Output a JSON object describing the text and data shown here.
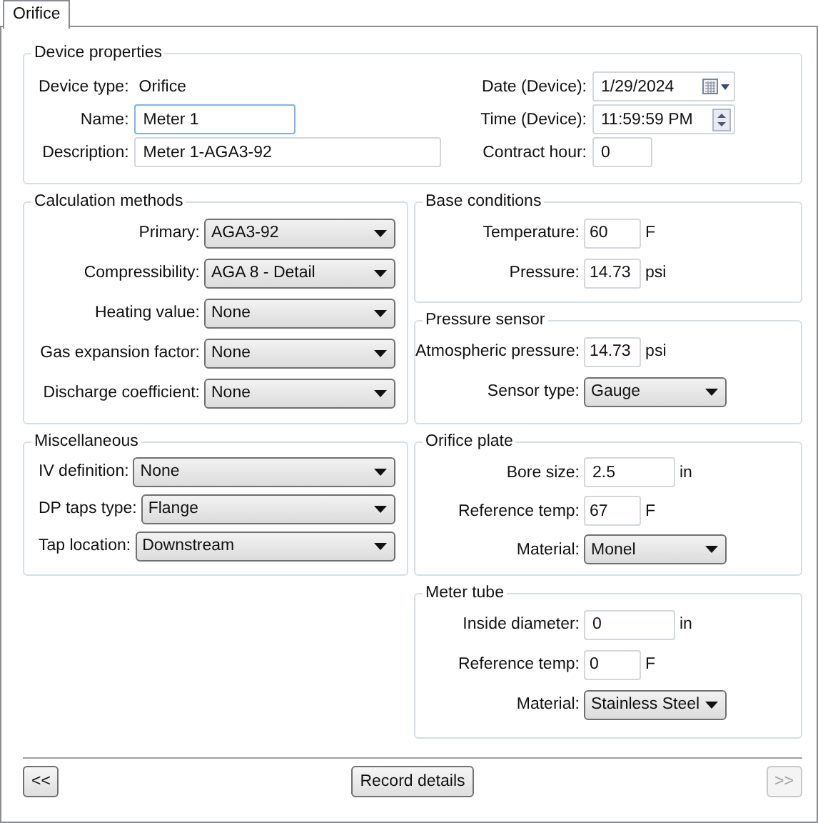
{
  "tab": {
    "label": "Orifice",
    "selected": true
  },
  "device_properties": {
    "title": "Device properties",
    "left": [
      {
        "kind": "static",
        "label": "Device type:",
        "value": "Orifice"
      },
      {
        "kind": "input",
        "label": "Name:",
        "value": "Meter 1",
        "focused": true
      },
      {
        "kind": "input",
        "label": "Description:",
        "value": "Meter 1-AGA3-92",
        "focused": false
      }
    ],
    "right": [
      {
        "kind": "date",
        "label": "Date (Device):",
        "value": "1/29/2024"
      },
      {
        "kind": "time",
        "label": "Time (Device):",
        "value": "11:59:59 PM"
      },
      {
        "kind": "number",
        "label": "Contract hour:",
        "value": "0"
      }
    ]
  },
  "left_groups": [
    {
      "title": "Calculation methods",
      "rows": [
        {
          "kind": "select",
          "label": "Primary:",
          "value": "AGA3-92"
        },
        {
          "kind": "select",
          "label": "Compressibility:",
          "value": "AGA 8 - Detail"
        },
        {
          "kind": "select",
          "label": "Heating value:",
          "value": "None"
        },
        {
          "kind": "select",
          "label": "Gas expansion factor:",
          "value": "None"
        },
        {
          "kind": "select",
          "label": "Discharge coefficient:",
          "value": "None"
        }
      ]
    },
    {
      "title": "Miscellaneous",
      "rows": [
        {
          "kind": "select",
          "label": "IV definition:",
          "value": "None"
        },
        {
          "kind": "select",
          "label": "DP taps type:",
          "value": "Flange"
        },
        {
          "kind": "select",
          "label": "Tap location:",
          "value": "Downstream"
        }
      ]
    }
  ],
  "right_groups": [
    {
      "title": "Base conditions",
      "rows": [
        {
          "kind": "number",
          "label": "Temperature:",
          "value": "60",
          "unit": "F"
        },
        {
          "kind": "number",
          "label": "Pressure:",
          "value": "14.73",
          "unit": "psi"
        }
      ]
    },
    {
      "title": "Pressure sensor",
      "rows": [
        {
          "kind": "number",
          "label": "Atmospheric pressure:",
          "value": "14.73",
          "unit": "psi"
        },
        {
          "kind": "select",
          "label": "Sensor type:",
          "value": "Gauge"
        }
      ]
    },
    {
      "title": "Orifice plate",
      "rows": [
        {
          "kind": "input",
          "label": "Bore size:",
          "value": "2.5",
          "unit": "in"
        },
        {
          "kind": "number",
          "label": "Reference temp:",
          "value": "67",
          "unit": "F"
        },
        {
          "kind": "select",
          "label": "Material:",
          "value": "Monel"
        }
      ]
    },
    {
      "title": "Meter tube",
      "rows": [
        {
          "kind": "input",
          "label": "Inside diameter:",
          "value": "0",
          "unit": "in"
        },
        {
          "kind": "number",
          "label": "Reference temp:",
          "value": "0",
          "unit": "F"
        },
        {
          "kind": "select",
          "label": "Material:",
          "value": "Stainless Steel"
        }
      ]
    }
  ],
  "buttons": [
    {
      "kind": "previous",
      "label": "<<",
      "disabled": false
    },
    {
      "kind": "record",
      "label": "Record details",
      "disabled": false
    },
    {
      "kind": "next",
      "label": ">>",
      "disabled": true
    }
  ]
}
